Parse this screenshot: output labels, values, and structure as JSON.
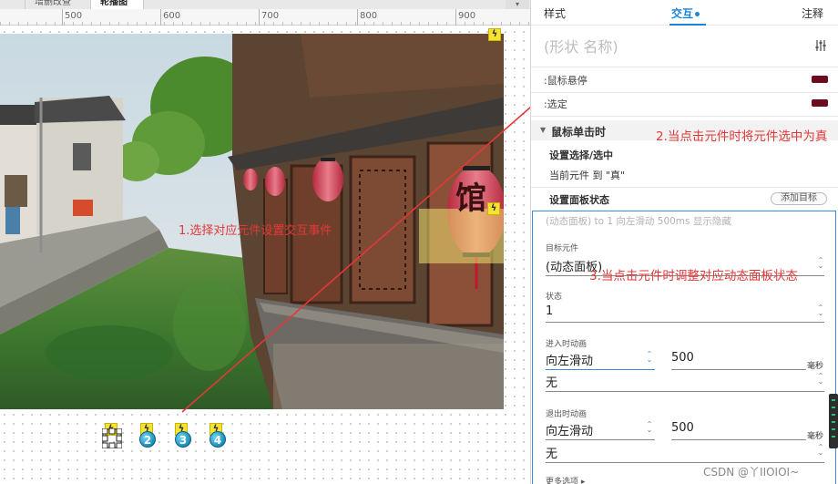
{
  "editor": {
    "tabs": [
      "",
      "增删改查",
      "轮播图"
    ],
    "ruler_labels": [
      "500",
      "600",
      "700",
      "800",
      "900"
    ]
  },
  "canvas": {
    "photo_alt": "",
    "photo_sign_text": "馆",
    "bullets": [
      "1",
      "2",
      "3",
      "4"
    ],
    "annotation_1": "1.选择对应元件设置交互事件"
  },
  "panel": {
    "tabs": {
      "style": "样式",
      "interaction": "交互",
      "notes": "注释"
    },
    "shape_name_placeholder": "(形状 名称)",
    "rows": {
      "hover": ":鼠标悬停",
      "selected": ":选定"
    },
    "section_title": "鼠标单击时",
    "action1_title": "设置选择/选中",
    "action1_desc": "当前元件 到 \"真\"",
    "action2_title": "设置面板状态",
    "add_target": "添加目标",
    "summary": "(动态面板) to 1 向左滑动 500ms 显示隐藏",
    "fields": {
      "target_label": "目标元件",
      "target_value": "(动态面板)",
      "state_label": "状态",
      "state_value": "1",
      "enter_label": "进入时动画",
      "enter_anim": "向左滑动",
      "enter_ms": "500",
      "enter_ease": "无",
      "exit_label": "退出时动画",
      "exit_anim": "向左滑动",
      "exit_ms": "500",
      "exit_ease": "无",
      "unit": "毫秒",
      "more": "更多选项 ▸"
    },
    "annotation_2": "2.当点击元件时将元件选中为真",
    "annotation_3": "3.当点击元件时调整对应动态面板状态"
  },
  "watermark": "CSDN @丫IIOIOI~",
  "colors": {
    "accent": "#1a85d8",
    "annotation": "#e33838",
    "swatch": "#6e0a1e",
    "bolt": "#f4e332"
  }
}
